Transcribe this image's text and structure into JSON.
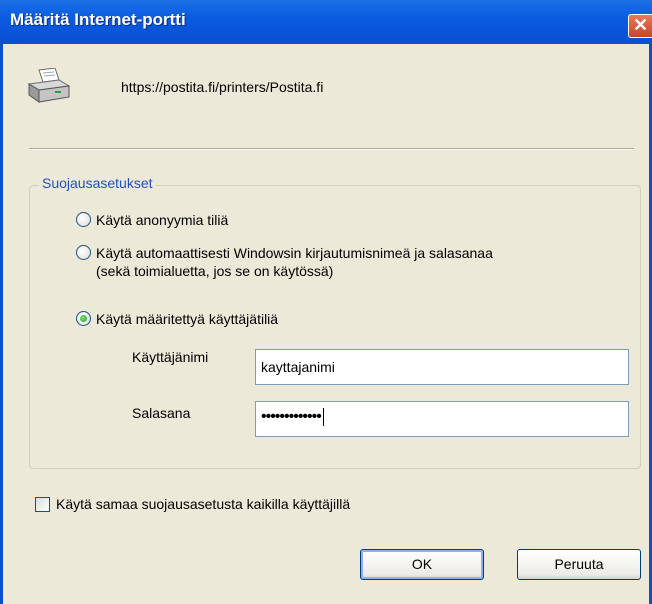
{
  "window": {
    "title": "Määritä Internet-portti",
    "close_glyph": "✕"
  },
  "header": {
    "url": "https://postita.fi/printers/Postita.fi",
    "icon": "printer-icon"
  },
  "security": {
    "legend": "Suojausasetukset",
    "options": [
      {
        "lines": [
          "Käytä anonyymia tiliä"
        ],
        "checked": false
      },
      {
        "lines": [
          "Käytä automaattisesti Windowsin kirjautumisnimeä ja salasanaa",
          "(sekä toimialuetta, jos se on käytössä)"
        ],
        "checked": false
      },
      {
        "lines": [
          "Käytä määritettyä käyttäjätiliä"
        ],
        "checked": true
      }
    ],
    "username_label": "Käyttäjänimi",
    "username_value": "kayttajanimi",
    "password_label": "Salasana",
    "password_value": "•••••••••••••"
  },
  "apply_all": {
    "label": "Käytä samaa suojausasetusta kaikilla käyttäjillä",
    "checked": false
  },
  "buttons": {
    "ok": "OK",
    "cancel": "Peruuta"
  },
  "colors": {
    "titlebar": "#0b4fd0",
    "dialog_bg": "#ece9d8",
    "legend": "#1f4fbf"
  }
}
